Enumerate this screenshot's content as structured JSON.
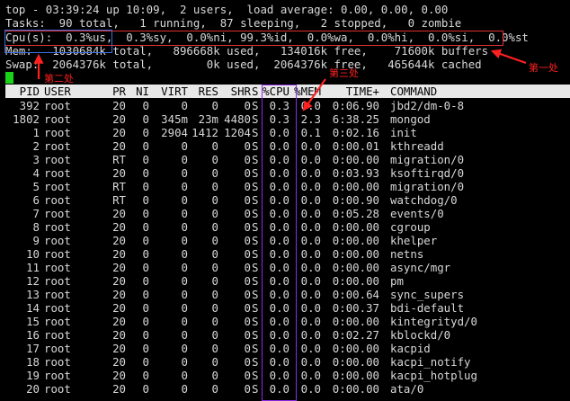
{
  "summary": {
    "line1": "top - 03:39:24 up 10:09,  2 users,  load average: 0.00, 0.00, 0.00",
    "line2": "Tasks:  90 total,   1 running,  87 sleeping,   2 stopped,   0 zombie",
    "line3": "Cpu(s):  0.3%us,  0.3%sy,  0.0%ni, 99.3%id,  0.0%wa,  0.0%hi,  0.0%si,  0.0%st",
    "line4": "Mem:   1030684k total,   896668k used,   134016k free,    71600k buffers",
    "line5": "Swap:  2064376k total,        0k used,  2064376k free,   465644k cached"
  },
  "columns": [
    "PID",
    "USER",
    "PR",
    "NI",
    "VIRT",
    "RES",
    "SHR",
    "S",
    "%CPU",
    "%MEM",
    "TIME+",
    "COMMAND"
  ],
  "rows": [
    [
      "392",
      "root",
      "20",
      "0",
      "0",
      "0",
      "0",
      "S",
      "0.3",
      "0.0",
      "0:06.90",
      "jbd2/dm-0-8"
    ],
    [
      "1802",
      "root",
      "20",
      "0",
      "345m",
      "23m",
      "4480",
      "S",
      "0.3",
      "2.3",
      "6:38.25",
      "mongod"
    ],
    [
      "1",
      "root",
      "20",
      "0",
      "2904",
      "1412",
      "1204",
      "S",
      "0.0",
      "0.1",
      "0:02.16",
      "init"
    ],
    [
      "2",
      "root",
      "20",
      "0",
      "0",
      "0",
      "0",
      "S",
      "0.0",
      "0.0",
      "0:00.01",
      "kthreadd"
    ],
    [
      "3",
      "root",
      "RT",
      "0",
      "0",
      "0",
      "0",
      "S",
      "0.0",
      "0.0",
      "0:00.00",
      "migration/0"
    ],
    [
      "4",
      "root",
      "20",
      "0",
      "0",
      "0",
      "0",
      "S",
      "0.0",
      "0.0",
      "0:03.93",
      "ksoftirqd/0"
    ],
    [
      "5",
      "root",
      "RT",
      "0",
      "0",
      "0",
      "0",
      "S",
      "0.0",
      "0.0",
      "0:00.00",
      "migration/0"
    ],
    [
      "6",
      "root",
      "RT",
      "0",
      "0",
      "0",
      "0",
      "S",
      "0.0",
      "0.0",
      "0:00.90",
      "watchdog/0"
    ],
    [
      "7",
      "root",
      "20",
      "0",
      "0",
      "0",
      "0",
      "S",
      "0.0",
      "0.0",
      "0:05.28",
      "events/0"
    ],
    [
      "8",
      "root",
      "20",
      "0",
      "0",
      "0",
      "0",
      "S",
      "0.0",
      "0.0",
      "0:00.00",
      "cgroup"
    ],
    [
      "9",
      "root",
      "20",
      "0",
      "0",
      "0",
      "0",
      "S",
      "0.0",
      "0.0",
      "0:00.00",
      "khelper"
    ],
    [
      "10",
      "root",
      "20",
      "0",
      "0",
      "0",
      "0",
      "S",
      "0.0",
      "0.0",
      "0:00.00",
      "netns"
    ],
    [
      "11",
      "root",
      "20",
      "0",
      "0",
      "0",
      "0",
      "S",
      "0.0",
      "0.0",
      "0:00.00",
      "async/mgr"
    ],
    [
      "12",
      "root",
      "20",
      "0",
      "0",
      "0",
      "0",
      "S",
      "0.0",
      "0.0",
      "0:00.00",
      "pm"
    ],
    [
      "13",
      "root",
      "20",
      "0",
      "0",
      "0",
      "0",
      "S",
      "0.0",
      "0.0",
      "0:00.64",
      "sync_supers"
    ],
    [
      "14",
      "root",
      "20",
      "0",
      "0",
      "0",
      "0",
      "S",
      "0.0",
      "0.0",
      "0:00.37",
      "bdi-default"
    ],
    [
      "15",
      "root",
      "20",
      "0",
      "0",
      "0",
      "0",
      "S",
      "0.0",
      "0.0",
      "0:00.00",
      "kintegrityd/0"
    ],
    [
      "16",
      "root",
      "20",
      "0",
      "0",
      "0",
      "0",
      "S",
      "0.0",
      "0.0",
      "0:02.27",
      "kblockd/0"
    ],
    [
      "17",
      "root",
      "20",
      "0",
      "0",
      "0",
      "0",
      "S",
      "0.0",
      "0.0",
      "0:00.00",
      "kacpid"
    ],
    [
      "18",
      "root",
      "20",
      "0",
      "0",
      "0",
      "0",
      "S",
      "0.0",
      "0.0",
      "0:00.00",
      "kacpi_notify"
    ],
    [
      "19",
      "root",
      "20",
      "0",
      "0",
      "0",
      "0",
      "S",
      "0.0",
      "0.0",
      "0:00.00",
      "kacpi_hotplug"
    ],
    [
      "20",
      "root",
      "20",
      "0",
      "0",
      "0",
      "0",
      "S",
      "0.0",
      "0.0",
      "0:00.00",
      "ata/0"
    ]
  ],
  "annotations": {
    "first": "第一处",
    "second": "第二处",
    "third": "第三处"
  },
  "colors": {
    "background": "#000000",
    "text": "#d8d8d8",
    "header_bg": "#e8e8e8",
    "annotation_red": "#ff2020",
    "box_red": "#e03030",
    "box_blue": "#3a6fe0",
    "box_purple": "#8a2be2",
    "cursor_green": "#18d318"
  }
}
